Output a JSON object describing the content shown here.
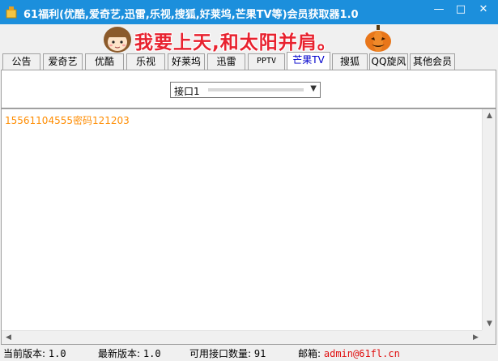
{
  "window": {
    "title": "61福利(优酷,爱奇艺,迅雷,乐视,搜狐,好莱坞,芒果TV等)会员获取器1.0",
    "minimize_icon": "minimize-icon",
    "maximize_icon": "maximize-icon",
    "close_icon": "close-icon"
  },
  "banner": {
    "text": "我要上天,和太阳并肩。"
  },
  "tabs": [
    {
      "label": "公告"
    },
    {
      "label": "爱奇艺"
    },
    {
      "label": "优酷"
    },
    {
      "label": "乐视"
    },
    {
      "label": "好莱坞"
    },
    {
      "label": "迅雷"
    },
    {
      "label": "PPTV"
    },
    {
      "label": "芒果TV",
      "active": true
    },
    {
      "label": "搜狐"
    },
    {
      "label": "QQ旋风"
    },
    {
      "label": "其他会员"
    }
  ],
  "interface_select": {
    "value": "接口1"
  },
  "content": {
    "lines": [
      "15561104555密码121203"
    ]
  },
  "status": {
    "current_version_label": "当前版本:",
    "current_version": "1.0",
    "latest_version_label": "最新版本:",
    "latest_version": "1.0",
    "available_count_label": "可用接口数量:",
    "available_count": "91",
    "mail_label": "邮箱:",
    "mail": "admin@61fl.cn"
  },
  "colors": {
    "titlebar": "#1c8fdc",
    "banner_text": "#e8222f",
    "content_text": "#ff8c00",
    "email": "#e01010",
    "active_tab_text": "#0000cc"
  }
}
